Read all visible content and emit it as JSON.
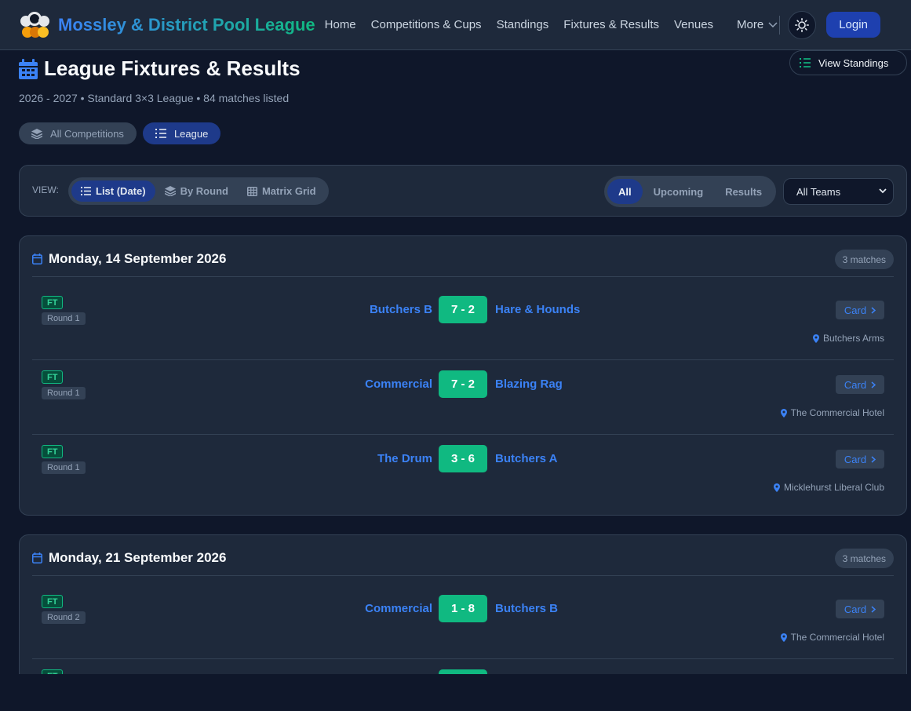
{
  "nav": {
    "brand": "Mossley & District Pool League",
    "links": [
      "Home",
      "Competitions & Cups",
      "Standings",
      "Fixtures & Results",
      "Venues"
    ],
    "more": "More",
    "login": "Login"
  },
  "page": {
    "title": "League Fixtures & Results",
    "subtitle": "2026 - 2027 • Standard 3×3 League • 84 matches listed",
    "view_standings": "View Standings"
  },
  "competition_pills": [
    "All Competitions",
    "League"
  ],
  "toolbar": {
    "view_label": "VIEW:",
    "views": [
      "List (Date)",
      "By Round",
      "Matrix Grid"
    ],
    "filters": [
      "All",
      "Upcoming",
      "Results"
    ],
    "team_select": "All Teams"
  },
  "groups": [
    {
      "date": "Monday, 14 September 2026",
      "count": "3 matches",
      "matches": [
        {
          "status": "FT",
          "round": "Round 1",
          "home": "Butchers B",
          "score": "7 - 2",
          "away": "Hare & Hounds",
          "card": "Card",
          "venue": "Butchers Arms"
        },
        {
          "status": "FT",
          "round": "Round 1",
          "home": "Commercial",
          "score": "7 - 2",
          "away": "Blazing Rag",
          "card": "Card",
          "venue": "The Commercial Hotel"
        },
        {
          "status": "FT",
          "round": "Round 1",
          "home": "The Drum",
          "score": "3 - 6",
          "away": "Butchers A",
          "card": "Card",
          "venue": "Micklehurst Liberal Club"
        }
      ]
    },
    {
      "date": "Monday, 21 September 2026",
      "count": "3 matches",
      "matches": [
        {
          "status": "FT",
          "round": "Round 2",
          "home": "Commercial",
          "score": "1 - 8",
          "away": "Butchers B",
          "card": "Card",
          "venue": "The Commercial Hotel"
        },
        {
          "status": "FT",
          "round": "",
          "home": "",
          "score": "",
          "away": "",
          "card": "",
          "venue": ""
        }
      ]
    }
  ],
  "colors": {
    "accent": "#3b82f6",
    "score_bg": "#10b981",
    "background": "#0f172a",
    "panel": "#1e293b"
  }
}
